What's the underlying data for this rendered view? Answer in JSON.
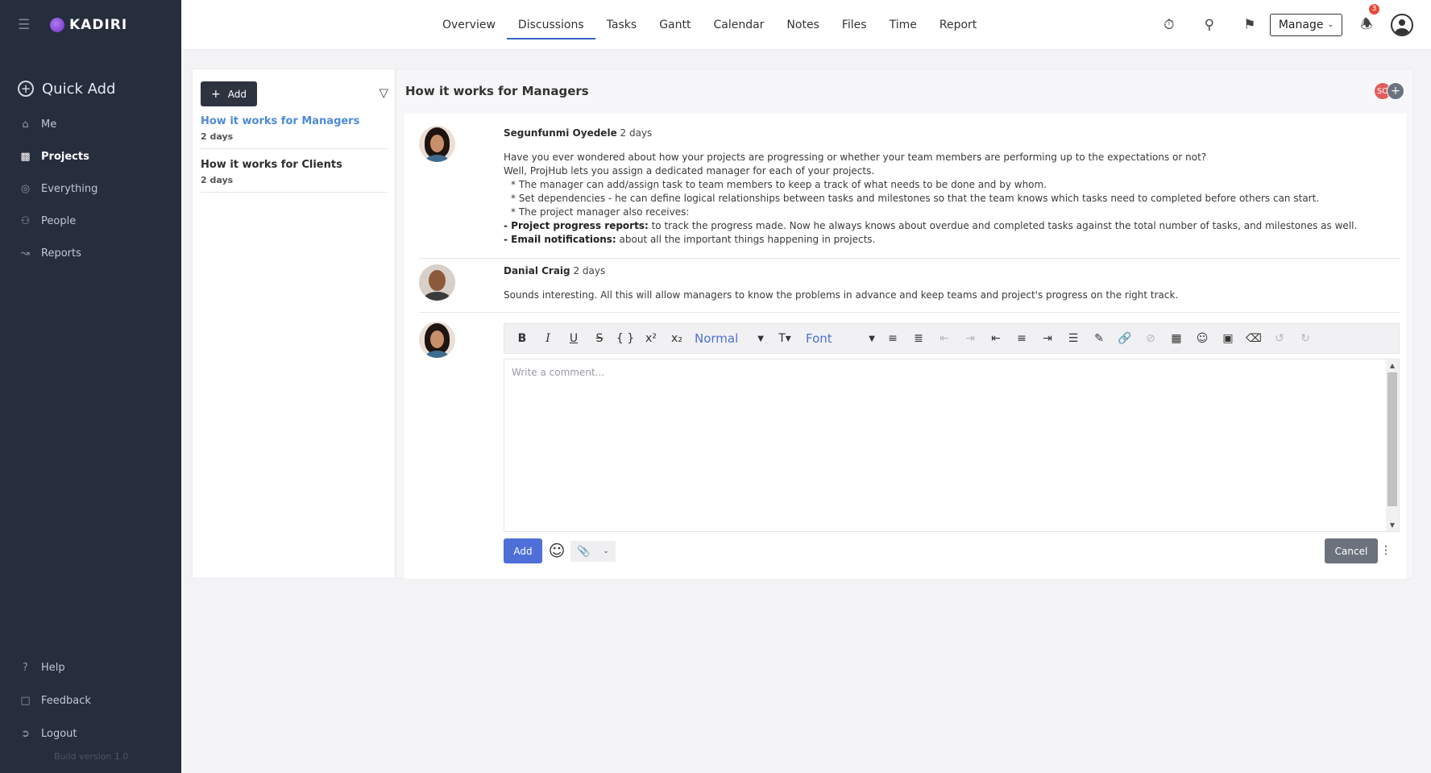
{
  "brand": {
    "name": "KADIRI",
    "accent": "#7b3fe4"
  },
  "sidebar": {
    "quick_add": "Quick Add",
    "items": [
      {
        "label": "Me",
        "icon": "home-icon"
      },
      {
        "label": "Projects",
        "icon": "folder-icon",
        "active": true
      },
      {
        "label": "Everything",
        "icon": "globe-icon"
      },
      {
        "label": "People",
        "icon": "people-icon"
      },
      {
        "label": "Reports",
        "icon": "chart-icon"
      }
    ],
    "bottom": [
      {
        "label": "Help",
        "icon": "help-icon"
      },
      {
        "label": "Feedback",
        "icon": "feedback-icon"
      },
      {
        "label": "Logout",
        "icon": "logout-icon"
      }
    ],
    "build": "Build version 1.0"
  },
  "topbar": {
    "tabs": [
      "Overview",
      "Discussions",
      "Tasks",
      "Gantt",
      "Calendar",
      "Notes",
      "Files",
      "Time",
      "Report"
    ],
    "active_tab": "Discussions",
    "manage": "Manage",
    "notification_count": "3"
  },
  "list_panel": {
    "add_label": "Add",
    "items": [
      {
        "title": "How it works for Managers",
        "date": "2 days",
        "active": true
      },
      {
        "title": "How it works for Clients",
        "date": "2 days"
      }
    ]
  },
  "discussion": {
    "title": "How it works for Managers",
    "participant_initials": "SO",
    "comments": [
      {
        "author": "Segunfunmi Oyedele",
        "time": "2 days",
        "lines": {
          "l1": "Have you ever wondered about how your projects are progressing or whether your team members are performing up to the expectations or not?",
          "l2": "Well, ProjHub lets you assign a dedicated manager for each of your projects.",
          "l3": "* The manager can add/assign task to team members to keep a track of what needs to be done and by whom.",
          "l4": "* Set dependencies - he can define logical relationships between tasks and milestones so that the team knows which tasks need to completed before others can start.",
          "l5": "* The project manager also receives:",
          "l6_prefix": "- ",
          "l6_bold": "Project progress reports:",
          "l6_rest": " to track the progress made. Now he always knows about overdue and completed tasks against the total number of tasks, and milestones as well.",
          "l7_prefix": "- ",
          "l7_bold": "Email notifications:",
          "l7_rest": " about all the important things happening in projects."
        }
      },
      {
        "author": "Danial Craig",
        "time": "2 days",
        "text": "Sounds interesting. All this will allow managers to know the problems in advance and keep teams and project's progress on the right track."
      }
    ]
  },
  "editor": {
    "format_select": "Normal",
    "font_select": "Font",
    "placeholder": "Write a comment...",
    "add_label": "Add",
    "cancel_label": "Cancel"
  }
}
